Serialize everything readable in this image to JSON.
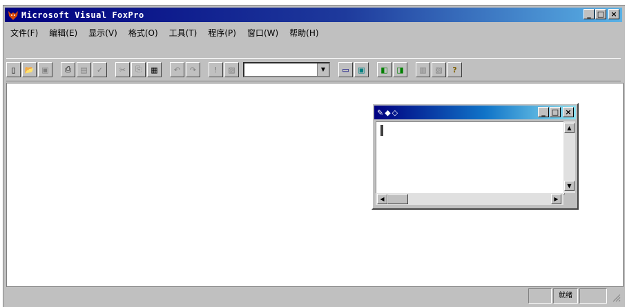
{
  "app": {
    "title": "Microsoft Visual FoxPro",
    "window_buttons": [
      "_",
      "□",
      "×"
    ]
  },
  "menu": [
    "文件(F)",
    "编辑(E)",
    "显示(V)",
    "格式(O)",
    "工具(T)",
    "程序(P)",
    "窗口(W)",
    "帮助(H)"
  ],
  "toolbar": {
    "combo_value": "",
    "group1": [
      {
        "name": "new-icon",
        "glyph": "▯"
      },
      {
        "name": "open-icon",
        "glyph": "📂"
      },
      {
        "name": "save-icon",
        "glyph": "▣"
      }
    ],
    "group2": [
      {
        "name": "print-icon",
        "glyph": "⎙"
      },
      {
        "name": "print-preview-icon",
        "glyph": "▤"
      },
      {
        "name": "spelling-icon",
        "glyph": "✓"
      }
    ],
    "group3": [
      {
        "name": "cut-icon",
        "glyph": "✂"
      },
      {
        "name": "copy-icon",
        "glyph": "⎘"
      },
      {
        "name": "paste-icon",
        "glyph": "▦"
      }
    ],
    "group4": [
      {
        "name": "undo-icon",
        "glyph": "↶"
      },
      {
        "name": "redo-icon",
        "glyph": "↷"
      }
    ],
    "group5": [
      {
        "name": "run-icon",
        "glyph": "!"
      },
      {
        "name": "modify-form-icon",
        "glyph": "▨"
      }
    ],
    "group6": [
      {
        "name": "command-window-icon",
        "glyph": "▭"
      },
      {
        "name": "view-window-icon",
        "glyph": "▣"
      }
    ],
    "group7": [
      {
        "name": "form-wizard-icon",
        "glyph": "◧"
      },
      {
        "name": "report-wizard-icon",
        "glyph": "◨"
      }
    ],
    "group8": [
      {
        "name": "autoform-icon",
        "glyph": "▥"
      },
      {
        "name": "autoreport-icon",
        "glyph": "▧"
      },
      {
        "name": "help-icon",
        "glyph": "?"
      }
    ]
  },
  "command_window": {
    "title_icons": "✎◆◇",
    "buttons": [
      "_",
      "□",
      "×"
    ]
  },
  "status": {
    "indicator": "就绪"
  }
}
